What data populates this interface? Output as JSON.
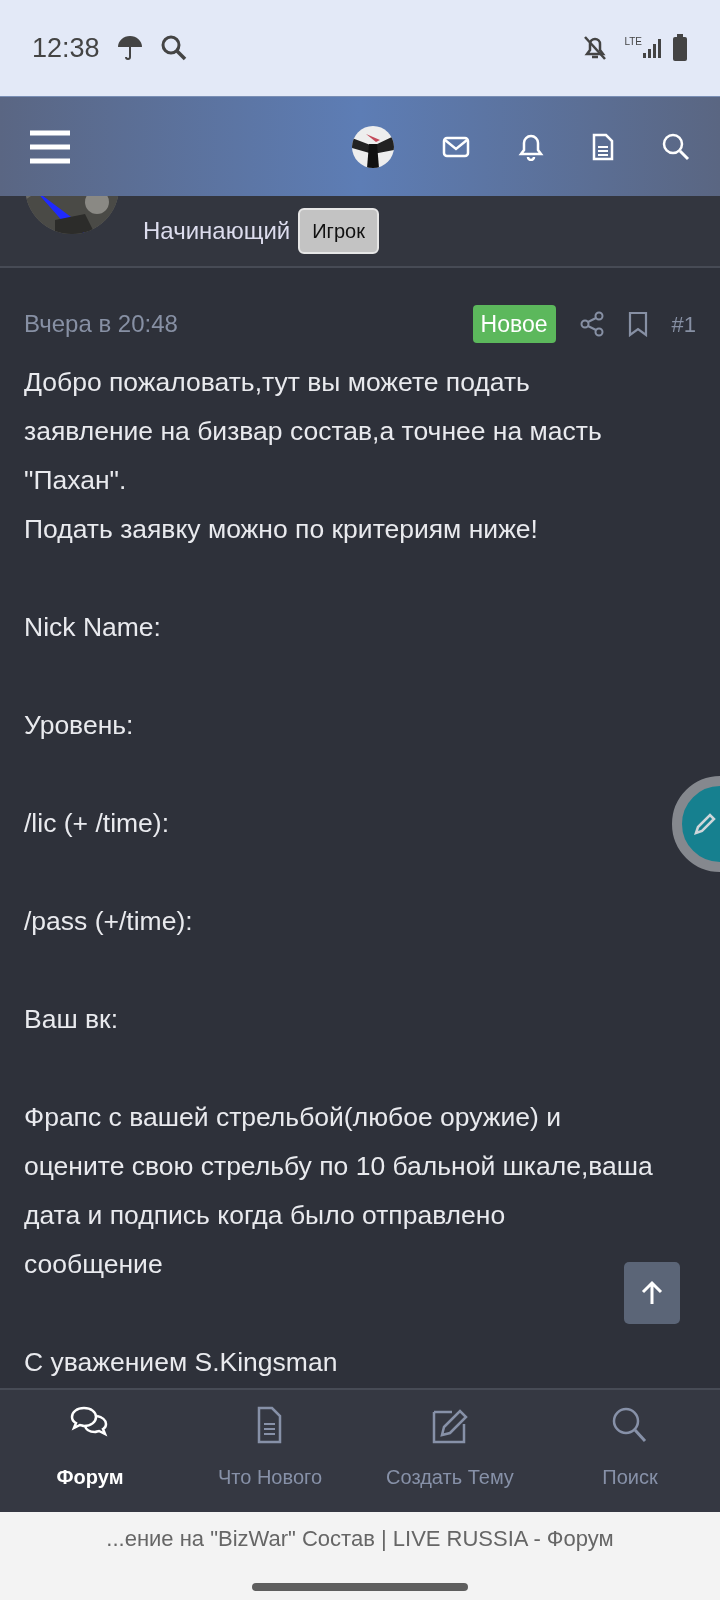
{
  "status_bar": {
    "time": "12:38",
    "network": "LTE"
  },
  "poster": {
    "rank": "Начинающий",
    "badge": "Игрок"
  },
  "post": {
    "date": "Вчера в 20:48",
    "badge": "Новое",
    "number": "#1",
    "paragraphs": [
      "Добро пожаловать,тут вы можете подать\nзаявление на бизвар состав,а точнее на масть\n\"Пахан\".\nПодать заявку можно по критериям ниже!",
      "Nick Name:",
      "Уровень:",
      "/lic (+ /time):",
      "/pass (+/time):",
      "Ваш вк:",
      "Фрапс с вашей стрельбой(любое оружие) и\nоцените свою стрельбу по 10 бальной шкале,ваша\nдата и подпись когда было отправлено\nсообщение",
      "С уважением S.Kingsman"
    ]
  },
  "bottom_nav": [
    {
      "label": "Форум",
      "kind": "chat",
      "selected": true
    },
    {
      "label": "Что Нового",
      "kind": "document",
      "selected": false
    },
    {
      "label": "Создать Тему",
      "kind": "compose",
      "selected": false
    },
    {
      "label": "Поиск",
      "kind": "search",
      "selected": false
    }
  ],
  "browser": {
    "title": "...ение на \"BizWar\" Состав | LIVE RUSSIA - Форум"
  }
}
